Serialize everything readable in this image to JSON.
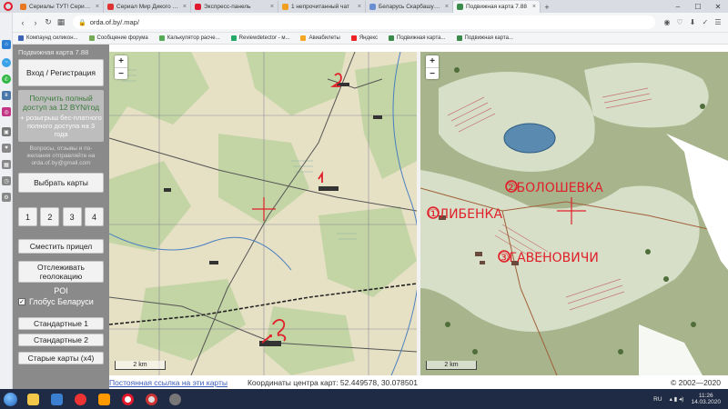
{
  "browser": {
    "tabs": [
      {
        "label": "Сериалы ТУТ! Сериалы он",
        "icon": "orange-square-icon",
        "color": "#e87722"
      },
      {
        "label": "Сериал Мир Дикого запа",
        "icon": "red-square-icon",
        "color": "#d33"
      },
      {
        "label": "Экспресс-панель",
        "icon": "opera-icon",
        "color": "#e0192d"
      },
      {
        "label": "1 непрочитанный чат",
        "icon": "chat-icon",
        "color": "#f0a020"
      },
      {
        "label": "Беларусь Скарбашукаль",
        "icon": "forum-icon",
        "color": "#6a8fd0"
      },
      {
        "label": "Подвижная карта 7.88",
        "icon": "globe-icon",
        "color": "#3a8a4a",
        "active": true
      }
    ],
    "url": "orda.of.by/.map/",
    "bookmarks": [
      {
        "label": "Компаунд силикон...",
        "color": "#3b62b5"
      },
      {
        "label": "Сообщение форума",
        "color": "#7a5"
      },
      {
        "label": "Калькулятор расче...",
        "color": "#5a5"
      },
      {
        "label": "Reviewdetector - м...",
        "color": "#2a6"
      },
      {
        "label": "Авиабилеты",
        "color": "#f5a623"
      },
      {
        "label": "Яндекс",
        "color": "#e22"
      },
      {
        "label": "Подвижная карта...",
        "color": "#3a8a4a"
      },
      {
        "label": "Подвижная карта...",
        "color": "#3a8a4a"
      }
    ]
  },
  "panel": {
    "title": "Подвижная карта 7.88",
    "login_label": "Вход / Регистрация",
    "promo_main": "Получить полный доступ за 12 BYN/год",
    "promo_sub": "+ розыгрыш бес-платного полного доступа на 3 года",
    "feedback": "Вопросы, отзывы и по-желания отправляйте на orda.of.by@gmail.com",
    "select_maps_label": "Выбрать карты",
    "layout_buttons": [
      "1",
      "2",
      "3",
      "4"
    ],
    "crosshair_label": "Сместить прицел",
    "geolocation_label": "Отслеживать геолокацию",
    "poi_label": "POI",
    "globus_label": "Глобус Беларуси",
    "standard1_label": "Стандартные 1",
    "standard2_label": "Стандартные 2",
    "old_maps_label": "Старые карты (х4)"
  },
  "map_left": {
    "zoom_in": "+",
    "zoom_out": "−",
    "scale": "2 km"
  },
  "map_right": {
    "zoom_in": "+",
    "zoom_out": "−",
    "scale": "2 km",
    "annotations": {
      "a1": "①ЛИБЕНКА",
      "a2": "②БОЛОШЕВКА",
      "a3": "③ГАВЕНОВИЧИ"
    }
  },
  "footer": {
    "permalink": "Постоянная ссылка на эти карты",
    "coords": "Координаты центра карт: 52.449578, 30.078501",
    "copyright": "© 2002—2020"
  },
  "taskbar": {
    "lang": "RU",
    "time": "11:26",
    "date": "14.03.2020"
  }
}
